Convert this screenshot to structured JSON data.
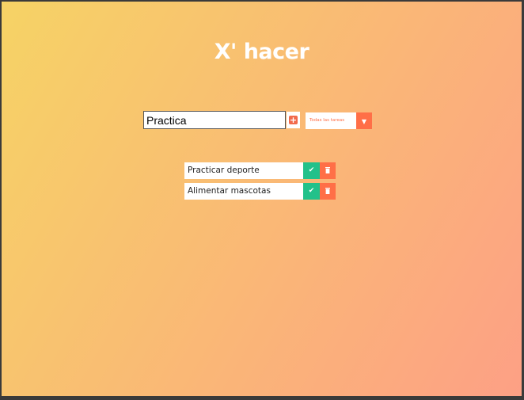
{
  "app": {
    "title": "X' hacer"
  },
  "form": {
    "input_value": "Practica",
    "add_icon": "plus-icon",
    "filter_selected": "Todas las tareas",
    "filter_icon": "chevron-down-icon"
  },
  "todos": [
    {
      "text": "Practicar deporte",
      "complete_icon": "check-icon",
      "delete_icon": "trash-icon"
    },
    {
      "text": "Alimentar mascotas",
      "complete_icon": "check-icon",
      "delete_icon": "trash-icon"
    }
  ],
  "colors": {
    "gradient_start": "#f6d365",
    "gradient_end": "#fda085",
    "accent": "#ff6f47",
    "complete": "#22c18a"
  }
}
